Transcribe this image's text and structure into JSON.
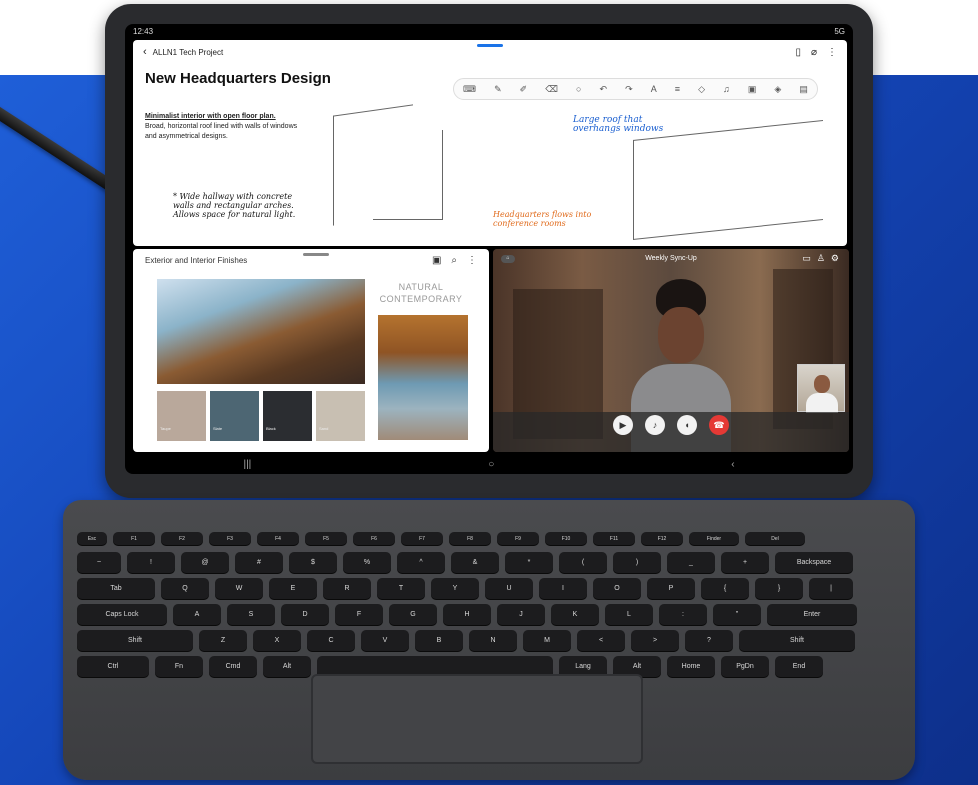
{
  "notes": {
    "status_time": "12:43",
    "status_signal": "5G",
    "breadcrumb": "ALLN1 Tech Project",
    "title": "New Headquarters Design",
    "body_heading": "Minimalist interior with open floor plan.",
    "body_text": "Broad, horizontal roof lined with walls of windows and asymmetrical designs.",
    "handwriting_1": "* Wide hallway with concrete walls and rectangular arches. Allows space for natural light.",
    "handwriting_2": "Large roof that overhangs windows",
    "handwriting_3": "Headquarters flows into conference rooms"
  },
  "gallery": {
    "title": "Exterior and Interior Finishes",
    "natural_label": "NATURAL CONTEMPORARY",
    "swatches": [
      {
        "label": "Taupe",
        "color": "#b9a89b"
      },
      {
        "label": "Slate",
        "color": "#4d6673"
      },
      {
        "label": "Black",
        "color": "#2b2d31"
      },
      {
        "label": "Sand",
        "color": "#c8bfb2"
      }
    ]
  },
  "call": {
    "title": "Weekly Sync-Up",
    "controls": [
      "Video",
      "Audio",
      "Speaker",
      "Leave"
    ]
  },
  "keyboard": {
    "frow": [
      "Esc",
      "F1",
      "F2",
      "F3",
      "F4",
      "F5",
      "F6",
      "F7",
      "F8",
      "F9",
      "F10",
      "F11",
      "F12",
      "Finder",
      "Del"
    ],
    "row1": [
      "~",
      "!",
      "@",
      "#",
      "$",
      "%",
      "^",
      "&",
      "*",
      "(",
      ")",
      "_",
      "+",
      "Backspace"
    ],
    "row2": [
      "Tab",
      "Q",
      "W",
      "E",
      "R",
      "T",
      "Y",
      "U",
      "I",
      "O",
      "P",
      "{",
      "}",
      "|"
    ],
    "row3": [
      "Caps Lock",
      "A",
      "S",
      "D",
      "F",
      "G",
      "H",
      "J",
      "K",
      "L",
      ":",
      "\"",
      "Enter"
    ],
    "row4": [
      "Shift",
      "Z",
      "X",
      "C",
      "V",
      "B",
      "N",
      "M",
      "<",
      ">",
      "?",
      "Shift"
    ],
    "row5": [
      "Ctrl",
      "Fn",
      "Cmd",
      "Alt",
      "",
      "Lang",
      "Alt",
      "Home",
      "PgDn",
      "End"
    ]
  }
}
